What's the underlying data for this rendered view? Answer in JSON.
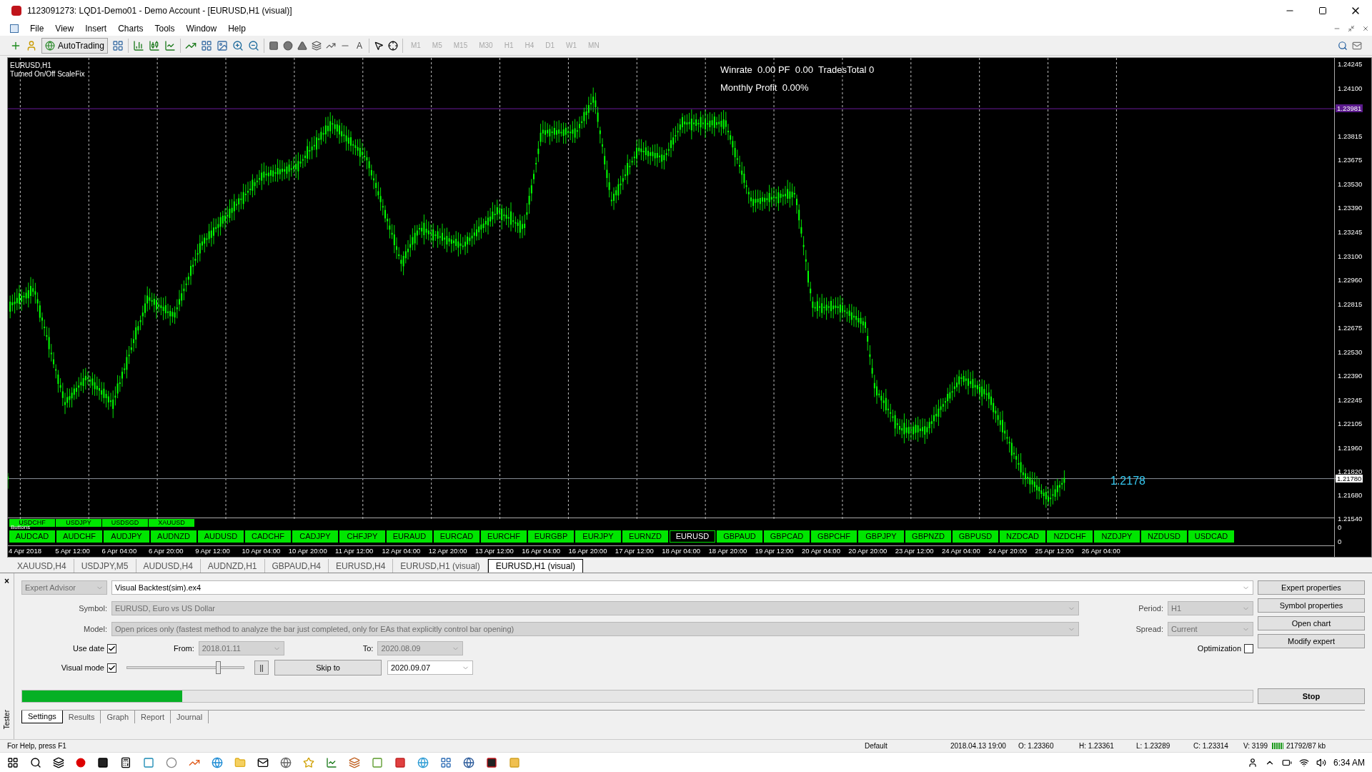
{
  "window": {
    "title": "1123091273: LQD1-Demo01 - Demo Account - [EURUSD,H1 (visual)]"
  },
  "menu": [
    "File",
    "View",
    "Insert",
    "Charts",
    "Tools",
    "Window",
    "Help"
  ],
  "toolbar": {
    "autotrading": "AutoTrading",
    "text_tool": "A",
    "timeframes": [
      {
        "label": "M1",
        "disabled": true
      },
      {
        "label": "M5",
        "disabled": true
      },
      {
        "label": "M15",
        "disabled": true
      },
      {
        "label": "M30",
        "disabled": true
      },
      {
        "label": "H1",
        "disabled": true
      },
      {
        "label": "H4",
        "disabled": true
      },
      {
        "label": "D1",
        "disabled": true
      },
      {
        "label": "W1",
        "disabled": true
      },
      {
        "label": "MN",
        "disabled": true
      }
    ]
  },
  "chart": {
    "symbol_label": "EURUSD,H1",
    "note": "Turned On/Off ScaleFix",
    "stats": [
      "Winrate  0.00 PF  0.00  TradesTotal 0",
      "Monthly Profit  0.00%"
    ],
    "price_label": "1.2178",
    "price_axis": [
      "1.24245",
      "1.24100",
      "1.23815",
      "1.23675",
      "1.23530",
      "1.23390",
      "1.23245",
      "1.23100",
      "1.22960",
      "1.22815",
      "1.22675",
      "1.22530",
      "1.22390",
      "1.22245",
      "1.22105",
      "1.21960",
      "1.21820",
      "1.21680",
      "1.21540"
    ],
    "price_markers": [
      {
        "value": "1.23981",
        "kind": "line"
      },
      {
        "value": "1.21780",
        "kind": "bid"
      }
    ],
    "indicator_axis": [
      "0",
      "0"
    ],
    "small_buttons": [
      "USDCHF",
      "USDJPY",
      "USDSGD",
      "XAUUSD"
    ],
    "buttons_caption": "Buttons",
    "symbol_buttons": [
      {
        "label": "AUDCAD",
        "selected": false
      },
      {
        "label": "AUDCHF",
        "selected": false
      },
      {
        "label": "AUDJPY",
        "selected": false
      },
      {
        "label": "AUDNZD",
        "selected": false
      },
      {
        "label": "AUDUSD",
        "selected": false
      },
      {
        "label": "CADCHF",
        "selected": false
      },
      {
        "label": "CADJPY",
        "selected": false
      },
      {
        "label": "CHFJPY",
        "selected": false
      },
      {
        "label": "EURAUD",
        "selected": false
      },
      {
        "label": "EURCAD",
        "selected": false
      },
      {
        "label": "EURCHF",
        "selected": false
      },
      {
        "label": "EURGBP",
        "selected": false
      },
      {
        "label": "EURJPY",
        "selected": false
      },
      {
        "label": "EURNZD",
        "selected": false
      },
      {
        "label": "EURUSD",
        "selected": true
      },
      {
        "label": "GBPAUD",
        "selected": false
      },
      {
        "label": "GBPCAD",
        "selected": false
      },
      {
        "label": "GBPCHF",
        "selected": false
      },
      {
        "label": "GBPJPY",
        "selected": false
      },
      {
        "label": "GBPNZD",
        "selected": false
      },
      {
        "label": "GBPUSD",
        "selected": false
      },
      {
        "label": "NZDCAD",
        "selected": false
      },
      {
        "label": "NZDCHF",
        "selected": false
      },
      {
        "label": "NZDJPY",
        "selected": false
      },
      {
        "label": "NZDUSD",
        "selected": false
      },
      {
        "label": "USDCAD",
        "selected": false
      }
    ],
    "dates": [
      "4 Apr 2018",
      "5 Apr 12:00",
      "6 Apr 04:00",
      "6 Apr 20:00",
      "9 Apr 12:00",
      "10 Apr 04:00",
      "10 Apr 20:00",
      "11 Apr 12:00",
      "12 Apr 04:00",
      "12 Apr 20:00",
      "13 Apr 12:00",
      "16 Apr 04:00",
      "16 Apr 20:00",
      "17 Apr 12:00",
      "18 Apr 04:00",
      "18 Apr 20:00",
      "19 Apr 12:00",
      "20 Apr 04:00",
      "20 Apr 20:00",
      "23 Apr 12:00",
      "24 Apr 04:00",
      "24 Apr 20:00",
      "25 Apr 12:00",
      "26 Apr 04:00"
    ]
  },
  "chart_tabs": [
    {
      "label": "XAUUSD,H4",
      "selected": false
    },
    {
      "label": "USDJPY,M5",
      "selected": false
    },
    {
      "label": "AUDUSD,H4",
      "selected": false
    },
    {
      "label": "AUDNZD,H1",
      "selected": false
    },
    {
      "label": "GBPAUD,H4",
      "selected": false
    },
    {
      "label": "EURUSD,H4",
      "selected": false
    },
    {
      "label": "EURUSD,H1 (visual)",
      "selected": false
    },
    {
      "label": "EURUSD,H1 (visual)",
      "selected": true
    }
  ],
  "tester": {
    "side_label": "Tester",
    "close": "×",
    "mode": {
      "value": "Expert Advisor",
      "disabled": true
    },
    "expert": {
      "value": "Visual Backtest(sim).ex4",
      "disabled": false
    },
    "symbol": {
      "label": "Symbol:",
      "value": "EURUSD, Euro vs US Dollar",
      "disabled": true
    },
    "model": {
      "label": "Model:",
      "value": "Open prices only (fastest method to analyze the bar just completed, only for EAs that explicitly control bar opening)",
      "disabled": true
    },
    "use_date": {
      "label": "Use date",
      "checked": true
    },
    "from": {
      "label": "From:",
      "value": "2018.01.11",
      "disabled": true
    },
    "to": {
      "label": "To:",
      "value": "2020.08.09",
      "disabled": true
    },
    "visual_mode": {
      "label": "Visual mode",
      "checked": true
    },
    "speed": {
      "level": 0.78
    },
    "pause": "||",
    "skip_to": "Skip to",
    "skip_date": {
      "value": "2020.09.07",
      "disabled": false
    },
    "period": {
      "label": "Period:",
      "value": "H1",
      "disabled": true
    },
    "spread": {
      "label": "Spread:",
      "value": "Current",
      "disabled": true
    },
    "optimization": {
      "label": "Optimization",
      "checked": false
    },
    "side_buttons": [
      "Expert properties",
      "Symbol properties",
      "Open chart",
      "Modify expert"
    ],
    "progress": {
      "level": 0.13
    },
    "stop": "Stop",
    "tabs": [
      {
        "label": "Settings",
        "selected": true
      },
      {
        "label": "Results",
        "selected": false
      },
      {
        "label": "Graph",
        "selected": false
      },
      {
        "label": "Report",
        "selected": false
      },
      {
        "label": "Journal",
        "selected": false
      }
    ]
  },
  "status_bar": {
    "help": "For Help, press F1",
    "profile": "Default",
    "time": "2018.04.13 19:00",
    "open": "O: 1.23360",
    "high": "H: 1.23361",
    "low": "L: 1.23289",
    "close": "C: 1.23314",
    "volume": "V: 3199",
    "traffic": "21792/87 kb"
  },
  "taskbar": {
    "time": "6:34 AM"
  }
}
